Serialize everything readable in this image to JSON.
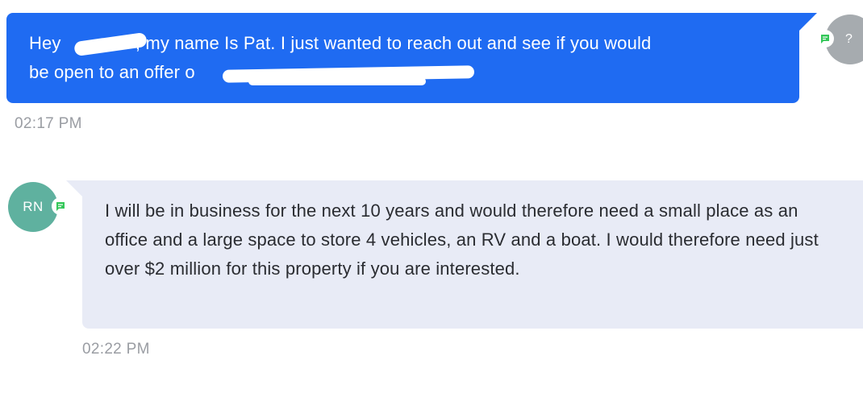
{
  "conversation": {
    "outgoing": {
      "text_start": "Hey ",
      "text_mid": ", my name Is Pat. I just wanted to reach out and see if you would",
      "text_line2": "be open to an offer o",
      "timestamp": "02:17 PM",
      "avatar_initials": "?"
    },
    "incoming": {
      "text": "I will be in business for the next 10 years and would therefore need a small place as an office and a large space to store 4 vehicles, an RV and a boat. I would therefore need just over $2 million for this property if you are interested.",
      "timestamp": "02:22 PM",
      "avatar_initials": "RN"
    }
  },
  "colors": {
    "outgoing_bubble": "#1f6bf2",
    "incoming_bubble": "#e8ebf6",
    "incoming_avatar": "#5fb19f",
    "outgoing_avatar": "#a6abaf",
    "sms_badge": "#34c759"
  },
  "icons": {
    "badge": "sms-chat-icon"
  }
}
